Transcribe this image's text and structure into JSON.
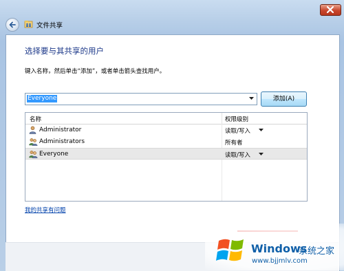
{
  "window": {
    "title": "文件共享",
    "close_icon": "close-icon"
  },
  "content": {
    "heading": "选择要与其共享的用户",
    "instruction": "键入名称，然后单击“添加”，或者单击箭头查找用户。",
    "combo": {
      "value": "Everyone"
    },
    "add_button": "添加(A)",
    "list": {
      "columns": [
        "名称",
        "权限级别"
      ],
      "rows": [
        {
          "name": "Administrator",
          "permission": "读取/写入",
          "has_dropdown": true,
          "icon": "user-icon"
        },
        {
          "name": "Administrators",
          "permission": "所有者",
          "has_dropdown": false,
          "icon": "group-icon"
        },
        {
          "name": "Everyone",
          "permission": "读取/写入",
          "has_dropdown": true,
          "icon": "group-icon",
          "selected": true
        }
      ]
    },
    "help_link": "我的共享有问题"
  },
  "watermark": {
    "brand": "Windows",
    "suffix": "系统之家",
    "url": "www.bjjmlv.com"
  },
  "colors": {
    "heading": "#1e3a8a",
    "link": "#0645ad",
    "selection": "#3399ff",
    "watermark": "#0f5fa8"
  }
}
